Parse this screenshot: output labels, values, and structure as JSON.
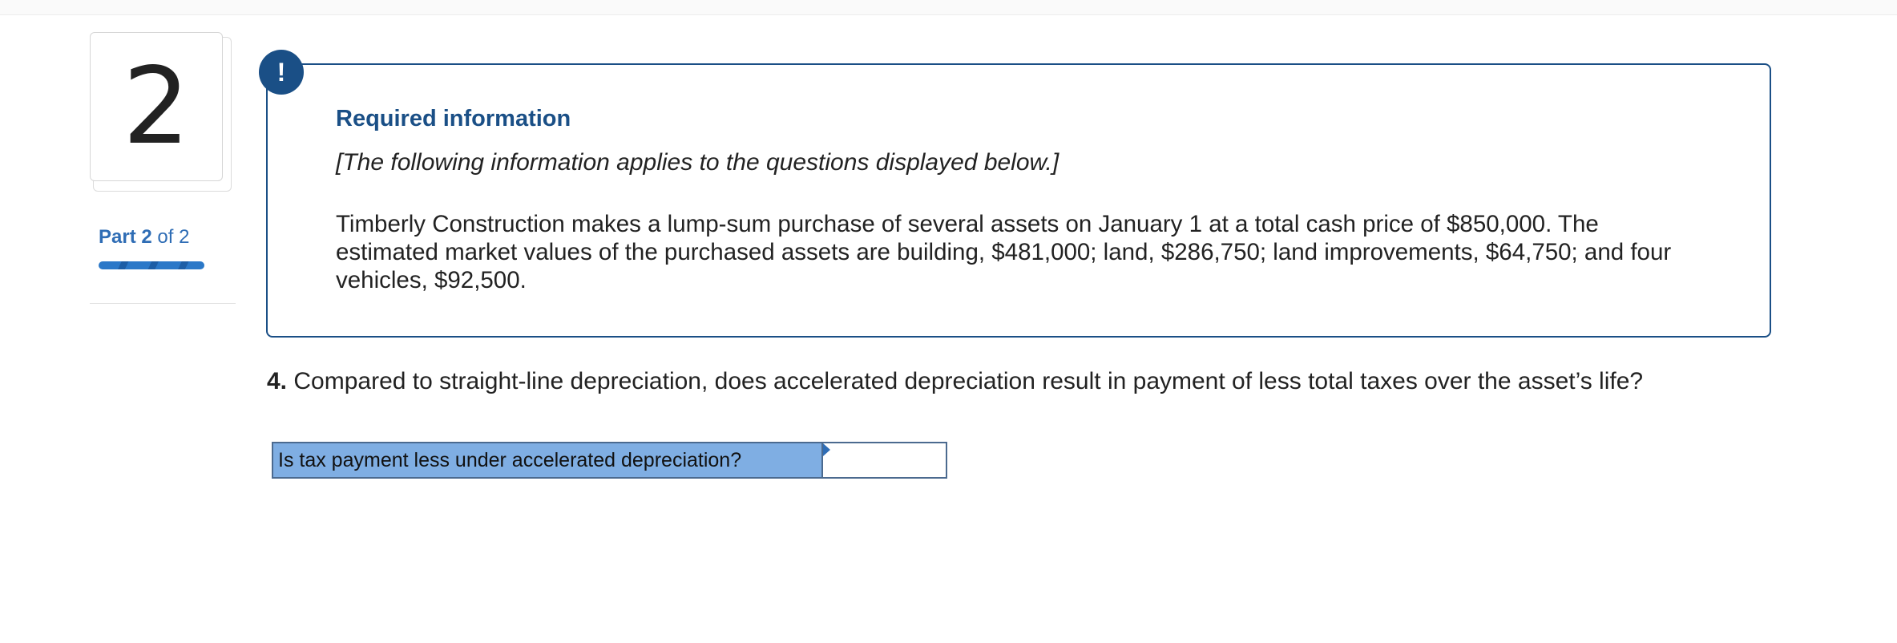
{
  "question_number": "2",
  "part": {
    "prefix": "Part",
    "current": "2",
    "suffix": "of 2",
    "progress_fraction": 1.0
  },
  "info": {
    "icon": "exclamation-icon",
    "badge_glyph": "!",
    "title": "Required information",
    "note": "[The following information applies to the questions displayed below.]",
    "body": "Timberly Construction makes a lump-sum purchase of several assets on January 1 at a total cash price of $850,000. The estimated market values of the purchased assets are building, $481,000; land, $286,750; land improvements, $64,750; and four vehicles, $92,500."
  },
  "question": {
    "number": "4.",
    "text": "Compared to straight-line depreciation, does accelerated depreciation result in payment of less total taxes over the asset’s life?"
  },
  "answer_table": {
    "row_label": "Is tax payment less under accelerated depreciation?",
    "selected_value": ""
  },
  "colors": {
    "accent": "#1a4f86",
    "link": "#2f6db5",
    "answer_label_bg": "#7faee3"
  }
}
